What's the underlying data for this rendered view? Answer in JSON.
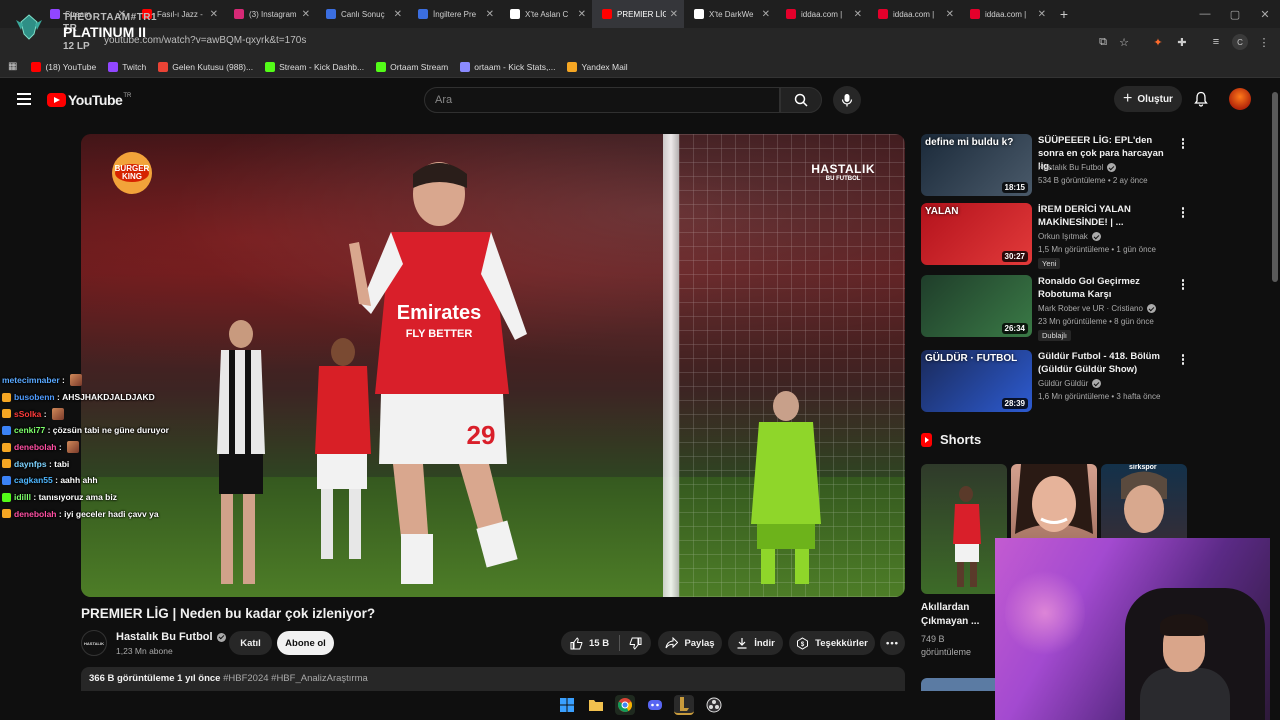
{
  "browser": {
    "tabs": [
      {
        "label": "Stream",
        "favicon_color": "#9146ff"
      },
      {
        "label": "Fasıl-ı Jazz -",
        "favicon_color": "#ff0000"
      },
      {
        "label": "(3) Instagram",
        "favicon_color": "#d62976"
      },
      {
        "label": "Canlı Sonuç",
        "favicon_color": "#3b6ee0"
      },
      {
        "label": "İngiltere Pre",
        "favicon_color": "#3b6ee0"
      },
      {
        "label": "X'te Aslan C",
        "favicon_color": "#ffffff"
      },
      {
        "label": "PREMIER LİG",
        "favicon_color": "#ff0000",
        "active": true
      },
      {
        "label": "X'te DarkWe",
        "favicon_color": "#ffffff"
      },
      {
        "label": "iddaa.com |",
        "favicon_color": "#e4002b"
      },
      {
        "label": "iddaa.com |",
        "favicon_color": "#e4002b"
      },
      {
        "label": "iddaa.com |",
        "favicon_color": "#e4002b"
      }
    ],
    "new_tab_label": "+",
    "url": "youtube.com/watch?v=awBQM-qxyrk&t=170s",
    "profile_initial": "C",
    "bookmarks": [
      {
        "label": "(18) YouTube",
        "color": "#ff0000"
      },
      {
        "label": "Twitch",
        "color": "#9146ff"
      },
      {
        "label": "Gelen Kutusu (988)...",
        "color": "#ea4335"
      },
      {
        "label": "Stream - Kick Dashb...",
        "color": "#53fc18"
      },
      {
        "label": "Ortaam Stream",
        "color": "#53fc18"
      },
      {
        "label": "ortaam - Kick Stats,...",
        "color": "#8a8aff"
      },
      {
        "label": "Yandex Mail",
        "color": "#f5a623"
      }
    ]
  },
  "rank_overlay": {
    "top": "THEORTAAM#TR1 TR",
    "title": "PLATINUM II",
    "lp": "12 LP"
  },
  "youtube": {
    "logo_text": "YouTube",
    "country": "TR",
    "search_placeholder": "Ara",
    "create_label": "Oluştur",
    "accent": "#ff0000"
  },
  "video": {
    "title": "PREMIER LİG | Neden bu kadar çok izleniyor?",
    "overlay_brand_top": "HASTALIK",
    "overlay_brand_bottom": "BU FUTBOL",
    "burger_king_top": "BURGER",
    "burger_king_bottom": "KING",
    "channel": {
      "name": "Hastalık Bu Futbol",
      "subscribers": "1,23 Mn abone",
      "avatar_text": "HASTALIK"
    },
    "join_label": "Katıl",
    "subscribe_label": "Abone ol",
    "likes": "15 B",
    "share_label": "Paylaş",
    "download_label": "İndir",
    "thanks_label": "Teşekkürler",
    "views_time": "366 B görüntüleme  1 yıl önce",
    "hashtags": "#HBF2024 #HBF_AnalizAraştırma"
  },
  "chat": [
    {
      "user": "metecimnaber",
      "color": "#5aa9ff",
      "msg": "",
      "emote": true,
      "badge": ""
    },
    {
      "user": "busobenn",
      "color": "#4f9cff",
      "msg": "AHSJHAKDJALDJAKD",
      "emote": false,
      "badge": "#f5a623"
    },
    {
      "user": "sSolka",
      "color": "#ff3b3b",
      "msg": "",
      "emote": true,
      "badge": "#f5a623"
    },
    {
      "user": "cenki77",
      "color": "#7dff6a",
      "msg": "çözsün tabi ne güne duruyor",
      "emote": false,
      "badge": "#3b82f6"
    },
    {
      "user": "denebolah",
      "color": "#ff4fa3",
      "msg": "",
      "emote": true,
      "badge": "#f5a623"
    },
    {
      "user": "daynfps",
      "color": "#7dd3ff",
      "msg": "tabi",
      "emote": false,
      "badge": "#f5a623"
    },
    {
      "user": "cagkan55",
      "color": "#4fb7ff",
      "msg": "aahh ahh",
      "emote": false,
      "badge": "#3b82f6"
    },
    {
      "user": "idilll",
      "color": "#7dff6a",
      "msg": "tanısıyoruz ama biz",
      "emote": false,
      "badge": "#53fc18"
    },
    {
      "user": "denebolah",
      "color": "#ff4fa3",
      "msg": "iyi geceler hadi çavv ya",
      "emote": false,
      "badge": "#f5a623"
    }
  ],
  "recommendations": [
    {
      "title": "SÜÜPEEER LİG: EPL'den sonra en çok para harcayan lig.",
      "channel": "Hastalık Bu Futbol",
      "meta": "534 B görüntüleme • 2 ay önce",
      "duration": "18:15",
      "badge": "",
      "thumb_text": "define mi buldu k?",
      "thumb_colors": [
        "#1b2a3a",
        "#4a5a6a"
      ]
    },
    {
      "title": "İREM DERİCİ YALAN MAKİNESİNDE! | ...",
      "channel": "Orkun Işıtmak",
      "meta": "1,5 Mn görüntüleme • 1 gün önce",
      "duration": "30:27",
      "badge": "Yeni",
      "thumb_text": "YALAN",
      "thumb_colors": [
        "#b3121c",
        "#e23a3a"
      ]
    },
    {
      "title": "Ronaldo Gol Geçirmez Robotuma Karşı",
      "channel": "Mark Rober ve UR · Cristiano",
      "meta": "23 Mn görüntüleme • 8 gün önce",
      "duration": "26:34",
      "badge": "Dublajlı",
      "thumb_text": "",
      "thumb_colors": [
        "#1f3d2a",
        "#3a7a46"
      ]
    },
    {
      "title": "Güldür Futbol - 418. Bölüm (Güldür Güldür Show)",
      "channel": "Güldür Güldür",
      "meta": "1,6 Mn görüntüleme • 3 hafta önce",
      "duration": "28:39",
      "badge": "",
      "thumb_text": "GÜLDÜR · FUTBOL",
      "thumb_colors": [
        "#1a2a5a",
        "#2d5bd1"
      ]
    }
  ],
  "shorts": {
    "heading": "Shorts",
    "first_title": "Akıllardan Çıkmayan ...",
    "first_views": "749 B görüntüleme",
    "third_label": "sirkspor"
  }
}
